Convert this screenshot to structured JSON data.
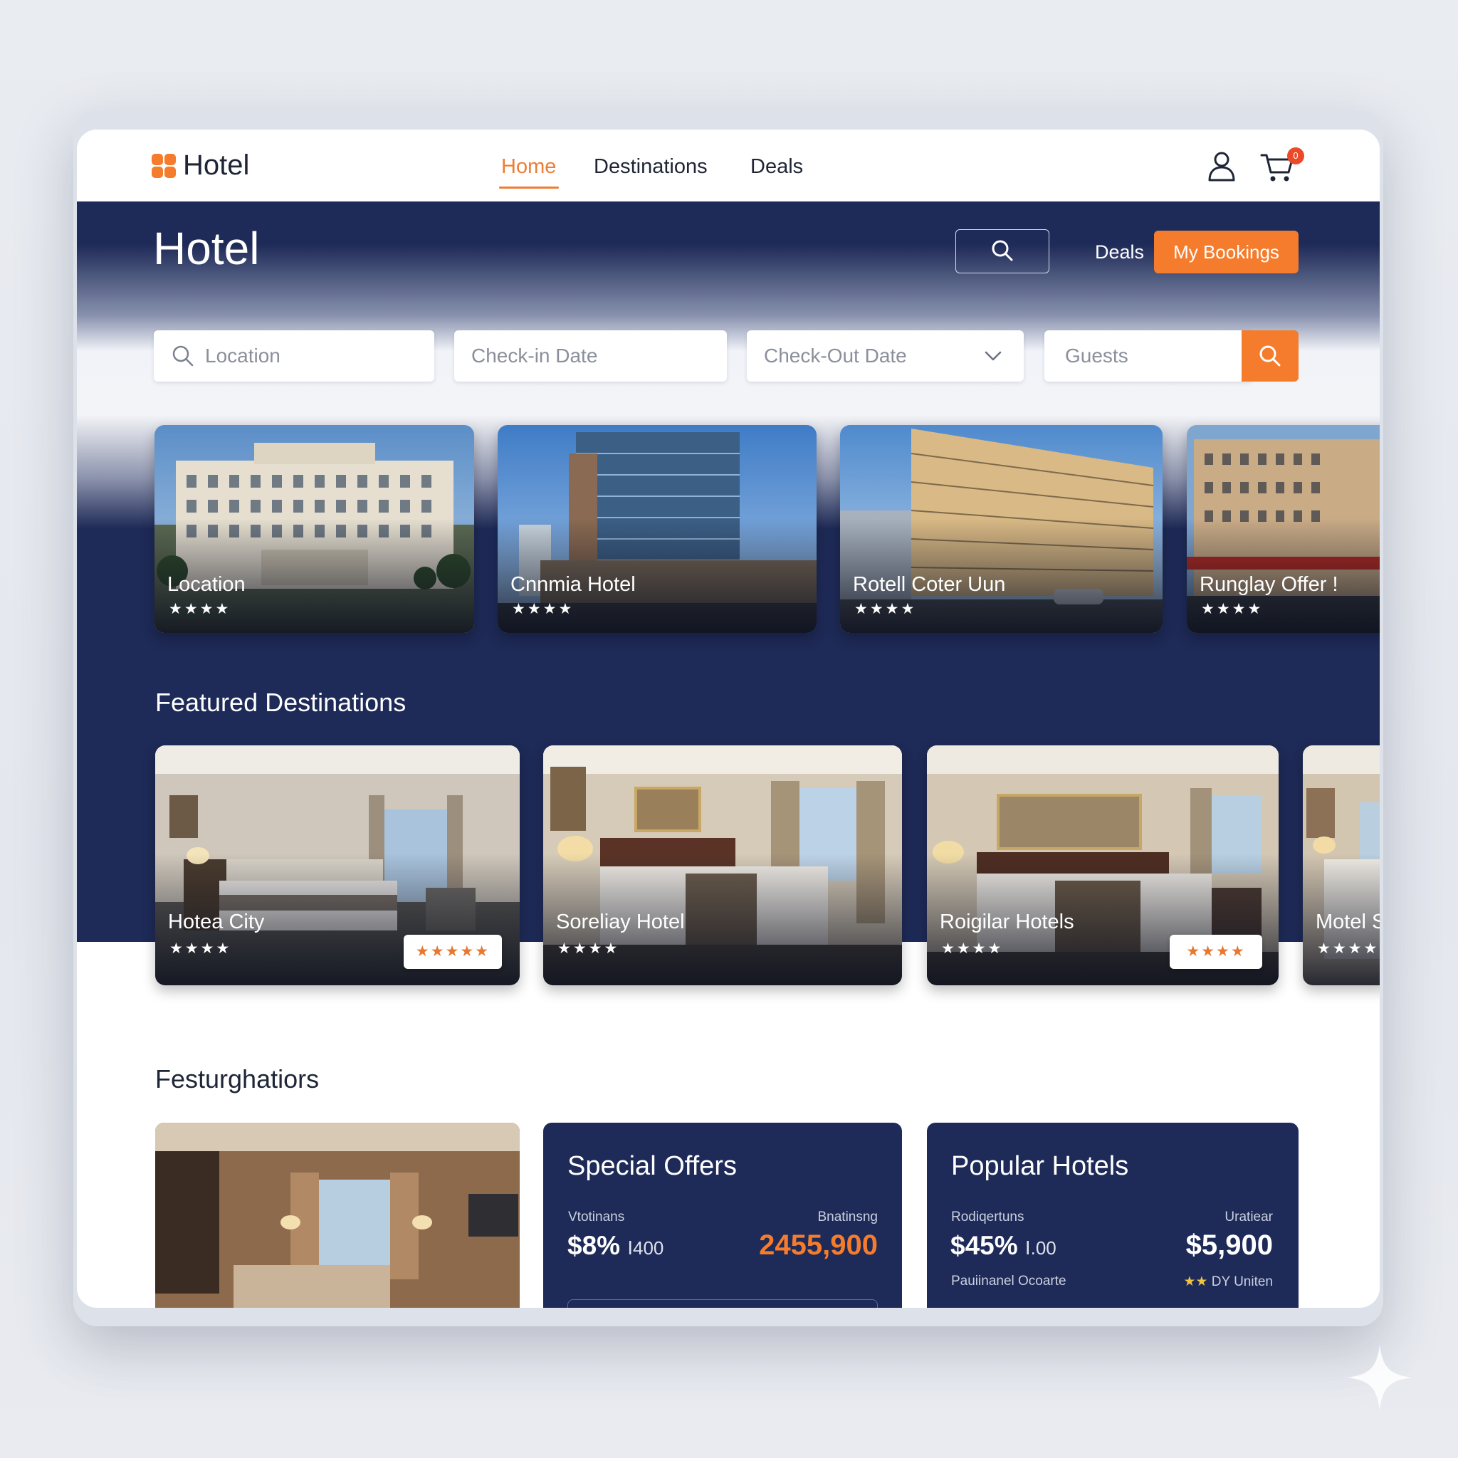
{
  "nav": {
    "brand": "Hotel",
    "links": [
      "Home",
      "Destinations",
      "Deals"
    ],
    "cart_count": "0"
  },
  "hero": {
    "title": "Hotel",
    "deals": "Deals",
    "bookings_button": "My Bookings"
  },
  "search": {
    "location_placeholder": "Location",
    "checkin_placeholder": "Check-in Date",
    "checkout_placeholder": "Check-Out Date",
    "guests_placeholder": "Guests"
  },
  "top_cards": [
    {
      "name": "Location",
      "stars": "★★★★"
    },
    {
      "name": "Cnnmia Hotel",
      "stars": "★★★★"
    },
    {
      "name": "Rotell Coter Uun",
      "stars": "★★★★"
    },
    {
      "name": "Runglay Offer !",
      "stars": "★★★★"
    }
  ],
  "featured": {
    "title": "Featured Destinations",
    "cards": [
      {
        "name": "Hotea City",
        "stars": "★★★★",
        "rating": "★★★★★"
      },
      {
        "name": "Soreliay Hotel",
        "stars": "★★★★"
      },
      {
        "name": "Roigilar Hotels",
        "stars": "★★★★",
        "rating": "★★★★"
      },
      {
        "name": "Motel S",
        "stars": "★★★★"
      }
    ]
  },
  "section2": {
    "title": "Festurghatiors"
  },
  "special_offers": {
    "title": "Special Offers",
    "left_label": "Vtotinans",
    "right_label": "Bnatinsng",
    "percent": "$8%",
    "percent_sub": "Ⅰ400",
    "price": "2455,900"
  },
  "popular_hotels": {
    "title": "Popular Hotels",
    "left_label": "Rodiqertuns",
    "right_label": "Uratiear",
    "percent": "$45%",
    "percent_sub": "Ⅰ.00",
    "price": "$5,900",
    "footer_left": "Pauiinanel Ocoarte",
    "footer_right": "DY Uniten",
    "footer_stars": "★★"
  },
  "colors": {
    "navy": "#1e2a57",
    "accent": "#f47c2c",
    "text_dark": "#1e2536"
  }
}
